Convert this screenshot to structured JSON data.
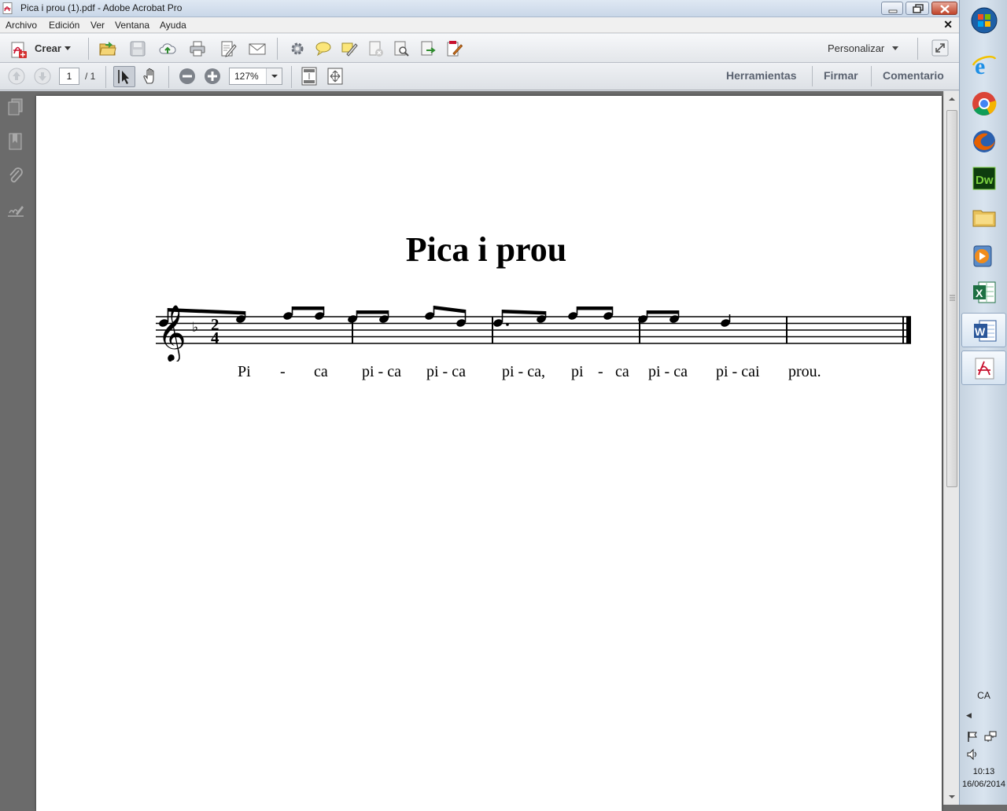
{
  "window": {
    "title": "Pica i prou (1).pdf - Adobe Acrobat Pro"
  },
  "menu": [
    "Archivo",
    "Edición",
    "Ver",
    "Ventana",
    "Ayuda"
  ],
  "toolbar": {
    "create_label": "Crear",
    "customize_label": "Personalizar"
  },
  "navigation": {
    "page_current": "1",
    "page_total": "/ 1",
    "zoom": "127%"
  },
  "panels": {
    "tools": "Herramientas",
    "sign": "Firmar",
    "comment": "Comentario"
  },
  "document": {
    "title": "Pica i prou",
    "time_signature": [
      "2",
      "4"
    ],
    "lyrics": [
      "Pi",
      "-",
      "ca",
      "pi - ca",
      "pi - ca",
      "pi - ca,",
      "pi",
      "-",
      "ca",
      "pi - ca",
      "pi - cai",
      "prou."
    ]
  },
  "taskbar": {
    "language": "CA",
    "time": "10:13",
    "date": "16/06/2014"
  },
  "colors": {
    "acrobat_red": "#c8102e",
    "doc_background": "#6b6b6b",
    "panel_text": "#5a6270"
  },
  "icons": [
    "start-orb-icon",
    "internet-explorer-icon",
    "chrome-icon",
    "firefox-icon",
    "dreamweaver-icon",
    "folder-icon",
    "media-player-icon",
    "excel-icon",
    "word-icon",
    "acrobat-icon"
  ]
}
